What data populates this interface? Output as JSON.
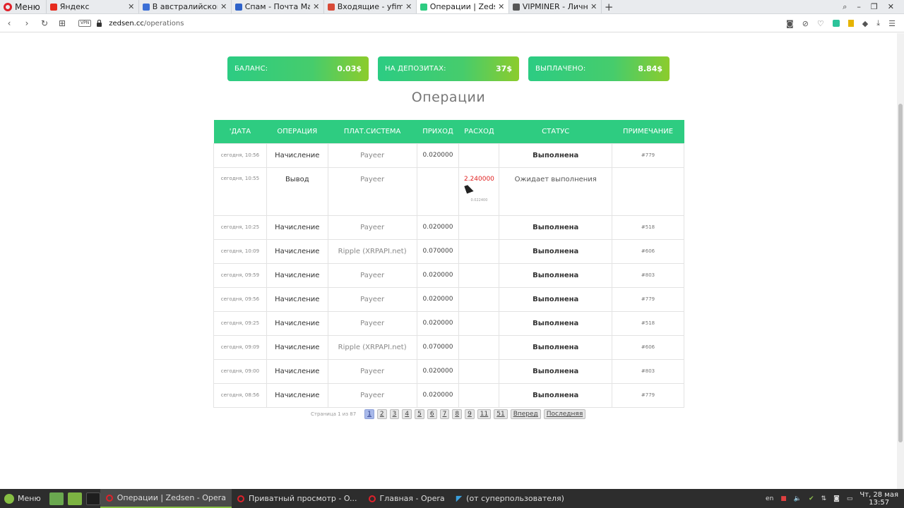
{
  "browser": {
    "menu_label": "Меню",
    "tabs": [
      {
        "title": "Яндекс",
        "color": "#e62b1e"
      },
      {
        "title": "В австралийском г",
        "color": "#3b6fd6"
      },
      {
        "title": "Спам - Почта Mail.r",
        "color": "#2e62c9"
      },
      {
        "title": "Входящие - yfimkin",
        "color": "#d84a38"
      },
      {
        "title": "Операции | Zedsen",
        "color": "#2ecc81",
        "active": true
      },
      {
        "title": "VIPMINER - Личный",
        "color": "#555555"
      }
    ],
    "url_domain": "zedsen.cc",
    "url_path": "/operations",
    "vpn_label": "VPN"
  },
  "summary": {
    "balance_label": "БАЛАНС:",
    "balance_value": "0.03$",
    "deposits_label": "НА ДЕПОЗИТАХ:",
    "deposits_value": "37$",
    "paid_label": "ВЫПЛАЧЕНО:",
    "paid_value": "8.84$"
  },
  "page_title": "Операции",
  "table": {
    "headers": {
      "date": "'ДАТА",
      "operation": "ОПЕРАЦИЯ",
      "system": "ПЛАТ.СИСТЕМА",
      "income": "ПРИХОД",
      "expense": "РАСХОД",
      "status": "СТАТУС",
      "note": "ПРИМЕЧАНИЕ"
    },
    "rows": [
      {
        "date": "сегодня, 10:56",
        "op": "Начисление",
        "system": "Payeer",
        "income": "0.020000",
        "expense": "",
        "status": "Выполнена",
        "note": "#779"
      },
      {
        "date": "сегодня, 10:55",
        "op": "Вывод",
        "system": "Payeer",
        "income": "",
        "expense": "2.240000",
        "expense_sub": "0.022400",
        "status": "Ожидает выполнения",
        "note": ""
      },
      {
        "date": "сегодня, 10:25",
        "op": "Начисление",
        "system": "Payeer",
        "income": "0.020000",
        "expense": "",
        "status": "Выполнена",
        "note": "#518"
      },
      {
        "date": "сегодня, 10:09",
        "op": "Начисление",
        "system": "Ripple (XRPAPI.net)",
        "income": "0.070000",
        "expense": "",
        "status": "Выполнена",
        "note": "#606"
      },
      {
        "date": "сегодня, 09:59",
        "op": "Начисление",
        "system": "Payeer",
        "income": "0.020000",
        "expense": "",
        "status": "Выполнена",
        "note": "#803"
      },
      {
        "date": "сегодня, 09:56",
        "op": "Начисление",
        "system": "Payeer",
        "income": "0.020000",
        "expense": "",
        "status": "Выполнена",
        "note": "#779"
      },
      {
        "date": "сегодня, 09:25",
        "op": "Начисление",
        "system": "Payeer",
        "income": "0.020000",
        "expense": "",
        "status": "Выполнена",
        "note": "#518"
      },
      {
        "date": "сегодня, 09:09",
        "op": "Начисление",
        "system": "Ripple (XRPAPI.net)",
        "income": "0.070000",
        "expense": "",
        "status": "Выполнена",
        "note": "#606"
      },
      {
        "date": "сегодня, 09:00",
        "op": "Начисление",
        "system": "Payeer",
        "income": "0.020000",
        "expense": "",
        "status": "Выполнена",
        "note": "#803"
      },
      {
        "date": "сегодня, 08:56",
        "op": "Начисление",
        "system": "Payeer",
        "income": "0.020000",
        "expense": "",
        "status": "Выполнена",
        "note": "#779"
      }
    ]
  },
  "pager": {
    "info": "Страница 1 из 87",
    "pages": [
      "1",
      "2",
      "3",
      "4",
      "5",
      "6",
      "7",
      "8",
      "9",
      "11",
      "51"
    ],
    "current": "1",
    "next_label": "Вперед",
    "last_label": "Последняя"
  },
  "taskbar": {
    "menu_label": "Меню",
    "tasks": [
      {
        "title": "Операции | Zedsen - Opera",
        "active": true
      },
      {
        "title": "Приватный просмотр - O...",
        "active": false
      },
      {
        "title": "Главная - Opera",
        "active": false
      },
      {
        "title": "(от суперпользователя)",
        "active": false
      }
    ],
    "lang": "en",
    "clock_date": "Чт, 28 мая",
    "clock_time": "13:57"
  }
}
